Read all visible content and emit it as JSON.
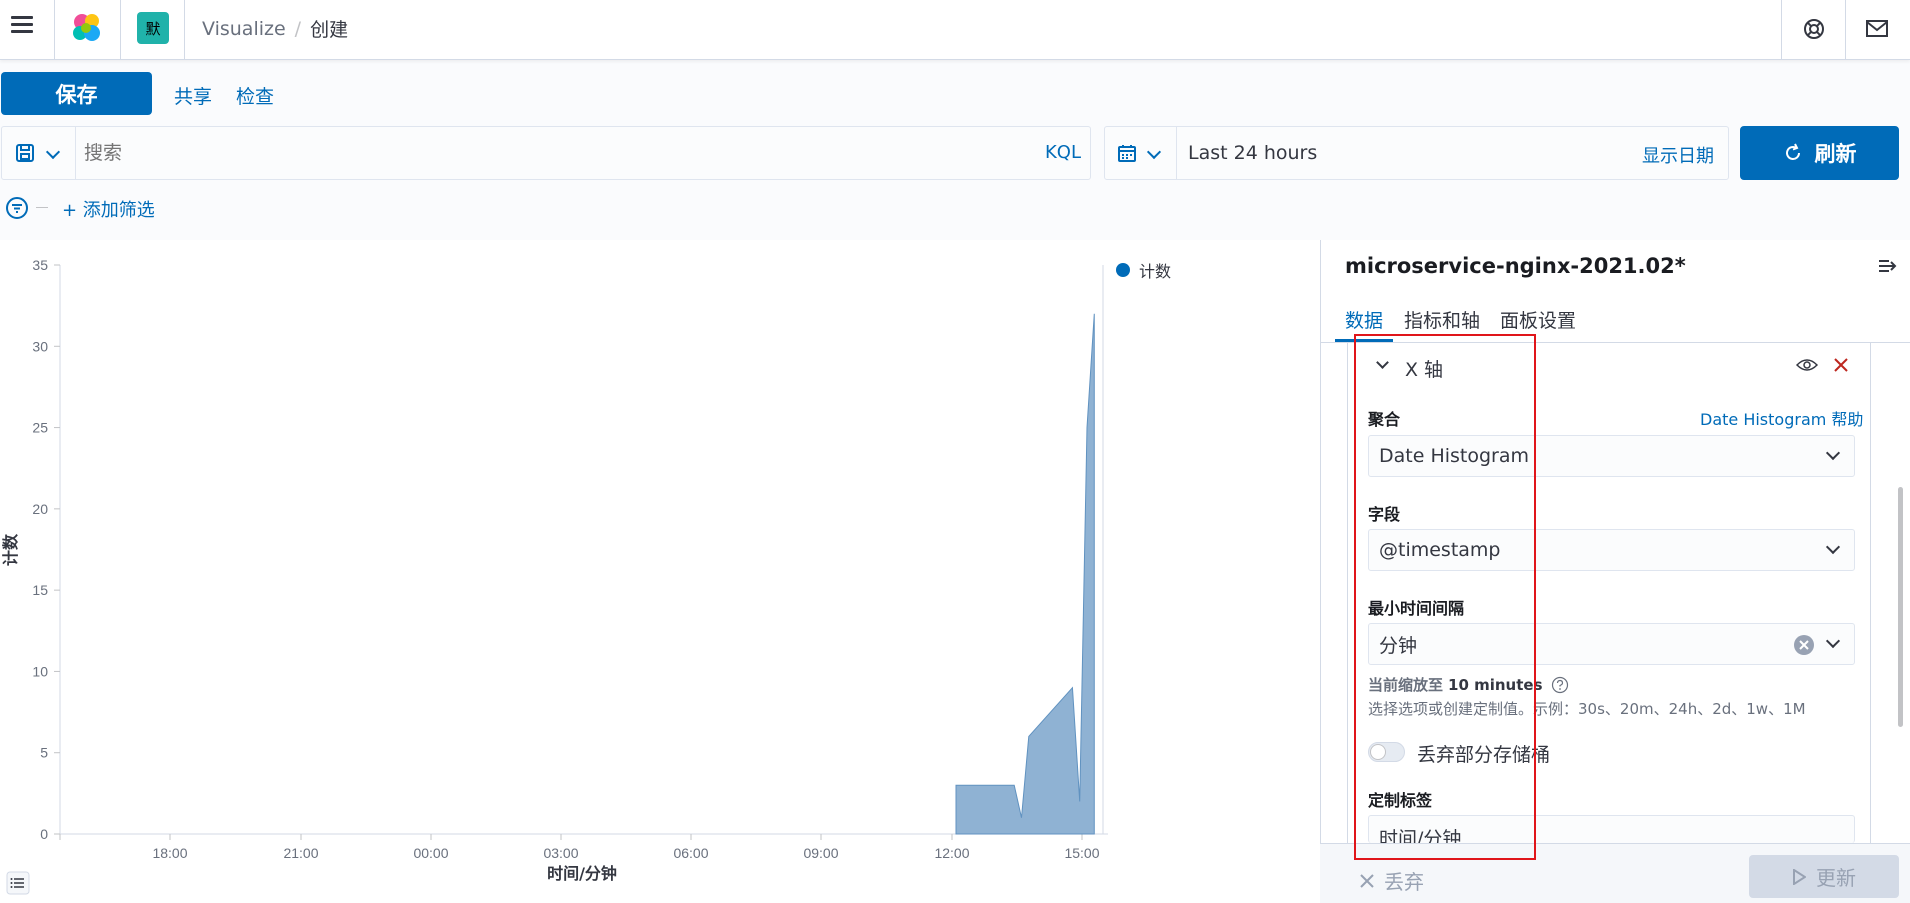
{
  "header": {
    "space_initial": "默",
    "breadcrumbs": [
      "Visualize",
      "创建"
    ]
  },
  "topnav": {
    "save_label": "保存",
    "share_label": "共享",
    "inspect_label": "检查"
  },
  "querybar": {
    "search_placeholder": "搜索",
    "language": "KQL",
    "time_range": "Last 24 hours",
    "show_dates_label": "显示日期",
    "refresh_label": "刷新"
  },
  "filterbar": {
    "add_filter_label": "+ 添加筛选"
  },
  "chart_data": {
    "type": "area",
    "ylabel": "计数",
    "xlabel": "时间/分钟",
    "legend": [
      "计数"
    ],
    "legend_position": "top-right",
    "ylim": [
      0,
      35
    ],
    "y_ticks": [
      "0",
      "5",
      "10",
      "15",
      "20",
      "25",
      "30",
      "35"
    ],
    "x_ticks": [
      "18:00",
      "21:00",
      "00:00",
      "03:00",
      "06:00",
      "09:00",
      "12:00",
      "15:00"
    ],
    "color": "#6092c0",
    "series": [
      {
        "name": "计数",
        "points": [
          [
            "12:00",
            3
          ],
          [
            "12:30",
            3
          ],
          [
            "13:00",
            3
          ],
          [
            "13:20",
            3
          ],
          [
            "13:30",
            1
          ],
          [
            "13:40",
            6
          ],
          [
            "14:00",
            7
          ],
          [
            "14:20",
            8
          ],
          [
            "14:40",
            9
          ],
          [
            "14:50",
            2
          ],
          [
            "15:00",
            25
          ],
          [
            "15:10",
            32
          ]
        ]
      }
    ]
  },
  "sidebar": {
    "index_title": "microservice-nginx-2021.02*",
    "tabs": [
      "数据",
      "指标和轴",
      "面板设置"
    ],
    "section_title": "X 轴",
    "agg_label": "聚合",
    "agg_help": "Date Histogram 帮助",
    "agg_value": "Date Histogram",
    "field_label": "字段",
    "field_value": "@timestamp",
    "interval_label": "最小时间间隔",
    "interval_value": "分钟",
    "interval_note_prefix": "当前缩放至",
    "interval_note_value": "10 minutes",
    "interval_hint": "选择选项或创建定制值。示例：30s、20m、24h、2d、1w、1M",
    "drop_partial_label": "丢弃部分存储桶",
    "custom_label_title": "定制标签",
    "custom_label_value": "时间/分钟",
    "discard_label": "丢弃",
    "update_label": "更新"
  },
  "colors": {
    "primary": "#006bb8",
    "area_fill": "#6092c0",
    "annotation_red": "#e0151a"
  }
}
